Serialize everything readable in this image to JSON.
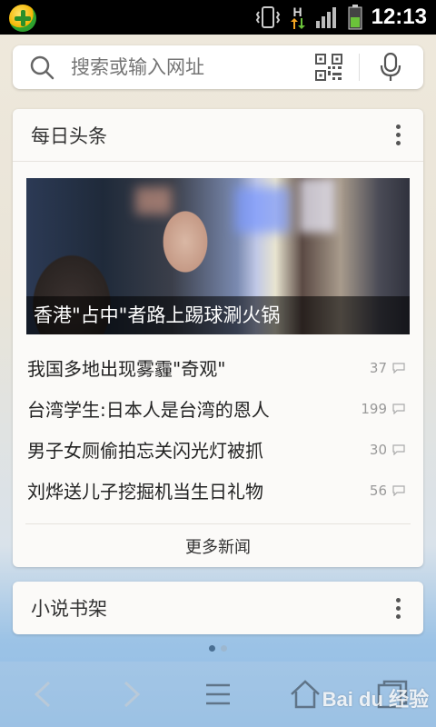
{
  "status_bar": {
    "time": "12:13",
    "network_type": "H"
  },
  "search": {
    "placeholder": "搜索或输入网址"
  },
  "news_card": {
    "title": "每日头条",
    "headline": "香港\"占中\"者路上踢球涮火锅",
    "items": [
      {
        "title": "我国多地出现雾霾\"奇观\"",
        "comments": "37"
      },
      {
        "title": "台湾学生:日本人是台湾的恩人",
        "comments": "199"
      },
      {
        "title": "男子女厕偷拍忘关闪光灯被抓",
        "comments": "30"
      },
      {
        "title": "刘烨送儿子挖掘机当生日礼物",
        "comments": "56"
      }
    ],
    "more_label": "更多新闻"
  },
  "novel_card": {
    "title": "小说书架"
  },
  "toolbar": {
    "icons": [
      "back-icon",
      "forward-icon",
      "menu-icon",
      "home-icon",
      "tabs-icon"
    ]
  },
  "watermark": {
    "text": "Bai du 经验"
  },
  "colors": {
    "status_bar_bg": "#000000",
    "card_bg": "#fbfaf8",
    "accent_network": "#f5a623",
    "battery_green": "#6bc23a"
  }
}
